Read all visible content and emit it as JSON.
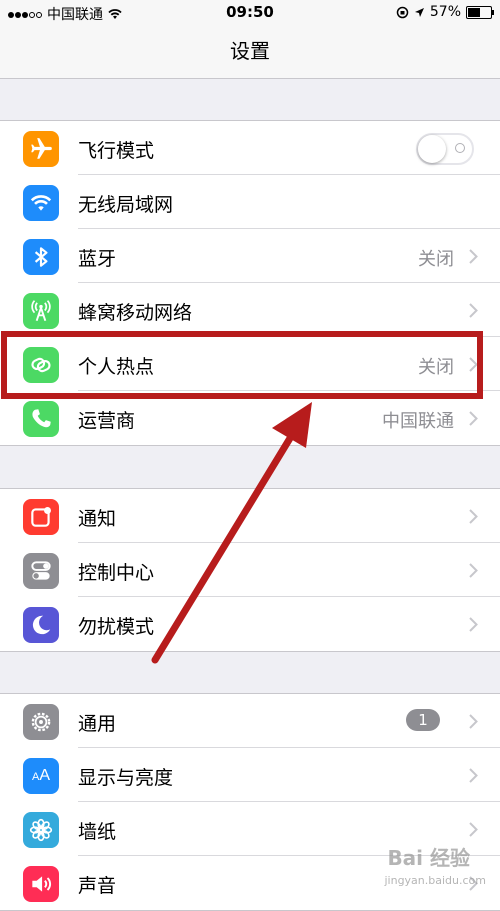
{
  "status_bar": {
    "carrier": "中国联通",
    "time": "09:50",
    "battery": "57%"
  },
  "nav": {
    "title": "设置"
  },
  "groups": [
    {
      "items": [
        {
          "label": "飞行模式",
          "icon": "airplane-icon",
          "color": "#ff9500",
          "toggle": "off"
        },
        {
          "label": "无线局域网",
          "icon": "wifi-icon",
          "color": "#1e8cfb"
        },
        {
          "label": "蓝牙",
          "icon": "bluetooth-icon",
          "color": "#1e8cfb",
          "value": "关闭"
        },
        {
          "label": "蜂窝移动网络",
          "icon": "cellular-icon",
          "color": "#4cd964"
        },
        {
          "label": "个人热点",
          "icon": "hotspot-icon",
          "color": "#4cd964",
          "value": "关闭"
        },
        {
          "label": "运营商",
          "icon": "phone-icon",
          "color": "#4cd964",
          "value": "中国联通"
        }
      ]
    },
    {
      "items": [
        {
          "label": "通知",
          "icon": "notifications-icon",
          "color": "#ff3b30"
        },
        {
          "label": "控制中心",
          "icon": "control-center-icon",
          "color": "#8e8e93"
        },
        {
          "label": "勿扰模式",
          "icon": "moon-icon",
          "color": "#5856d6"
        }
      ]
    },
    {
      "items": [
        {
          "label": "通用",
          "icon": "gear-icon",
          "color": "#8e8e93",
          "badge": "1"
        },
        {
          "label": "显示与亮度",
          "icon": "display-icon",
          "color": "#1e8cfb"
        },
        {
          "label": "墙纸",
          "icon": "wallpaper-icon",
          "color": "#34aadc"
        },
        {
          "label": "声音",
          "icon": "sound-icon",
          "color": "#ff2d55"
        }
      ]
    }
  ],
  "annotation": {
    "highlight_color": "#b71c1c"
  },
  "watermark": {
    "text": "Bai 经验",
    "sub": "jingyan.baidu.com"
  }
}
